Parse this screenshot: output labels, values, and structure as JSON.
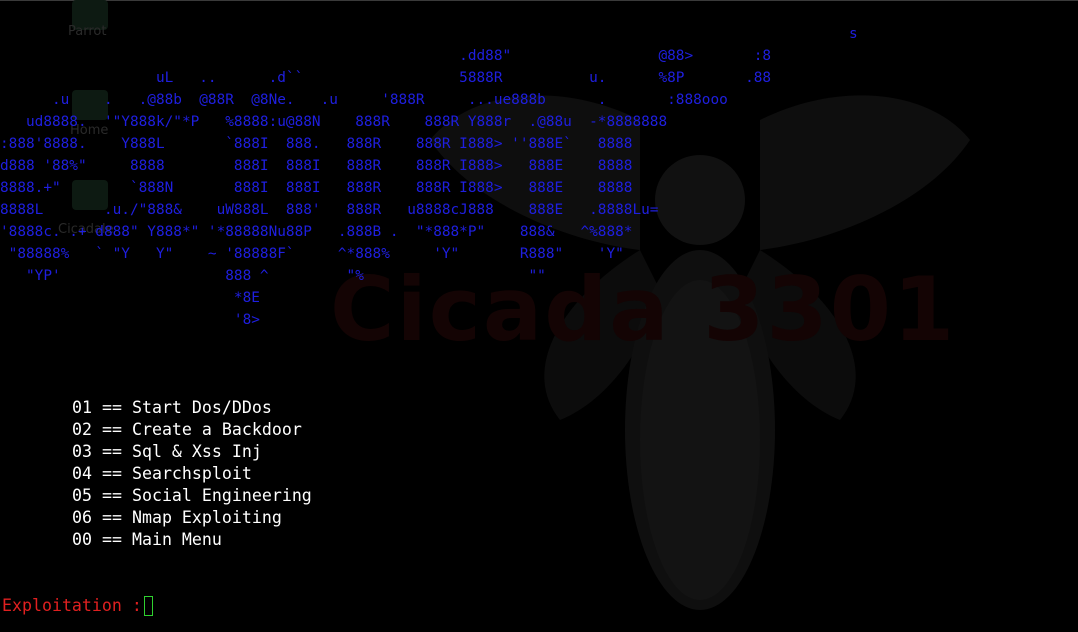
{
  "desktop": {
    "icons": [
      {
        "label": "Parrot"
      },
      {
        "label": "Home"
      },
      {
        "label": "Cicadale"
      }
    ],
    "background_text": "Cicada 3301"
  },
  "banner": {
    "lines": [
      "                                                                                                  s",
      "                                                     .dd88\"                 @88>       :8",
      "                  uL   ..      .d``                  5888R          u.      %8P       .88",
      "      .u    .   .@88b  @88R  @8Ne.   .u     '888R     ...ue888b      .       :888ooo",
      "   ud8888.  '\"Y888k/\"*P   %8888:u@88N    888R    888R Y888r  .@88u  -*8888888",
      ":888'8888.    Y888L       `888I  888.   888R    888R I888> ''888E`   8888",
      "d888 '88%\"     8888        888I  888I   888R    888R I888>   888E    8888",
      "8888.+\"        `888N       888I  888I   888R    888R I888>   888E    8888",
      "8888L       .u./\"888&    uW888L  888'   888R   u8888cJ888    888E   .8888Lu=",
      "'8888c. .+ d888\" Y888*\" '*88888Nu88P   .888B .  \"*888*P\"    888&   ^%888*",
      " \"88888%   ` \"Y   Y\"    ~ '88888F`     ^*888%     'Y\"       R888\"    'Y\"",
      "   \"YP'                   888 ^         \"%                   \"\"",
      "                           *8E",
      "                           '8>"
    ]
  },
  "menu": {
    "items": [
      {
        "number": "01",
        "label": "Start Dos/DDos"
      },
      {
        "number": "02",
        "label": "Create a Backdoor"
      },
      {
        "number": "03",
        "label": "Sql & Xss Inj"
      },
      {
        "number": "04",
        "label": "Searchsploit"
      },
      {
        "number": "05",
        "label": "Social Engineering"
      },
      {
        "number": "06",
        "label": "Nmap Exploiting"
      },
      {
        "number": "00",
        "label": "Main Menu"
      }
    ],
    "separator": "=="
  },
  "prompt": {
    "text": "Exploitation :"
  },
  "colors": {
    "background": "#000000",
    "banner": "#1f1fe0",
    "menu_text": "#ffffff",
    "prompt": "#e02020",
    "cursor": "#2fd12f"
  }
}
